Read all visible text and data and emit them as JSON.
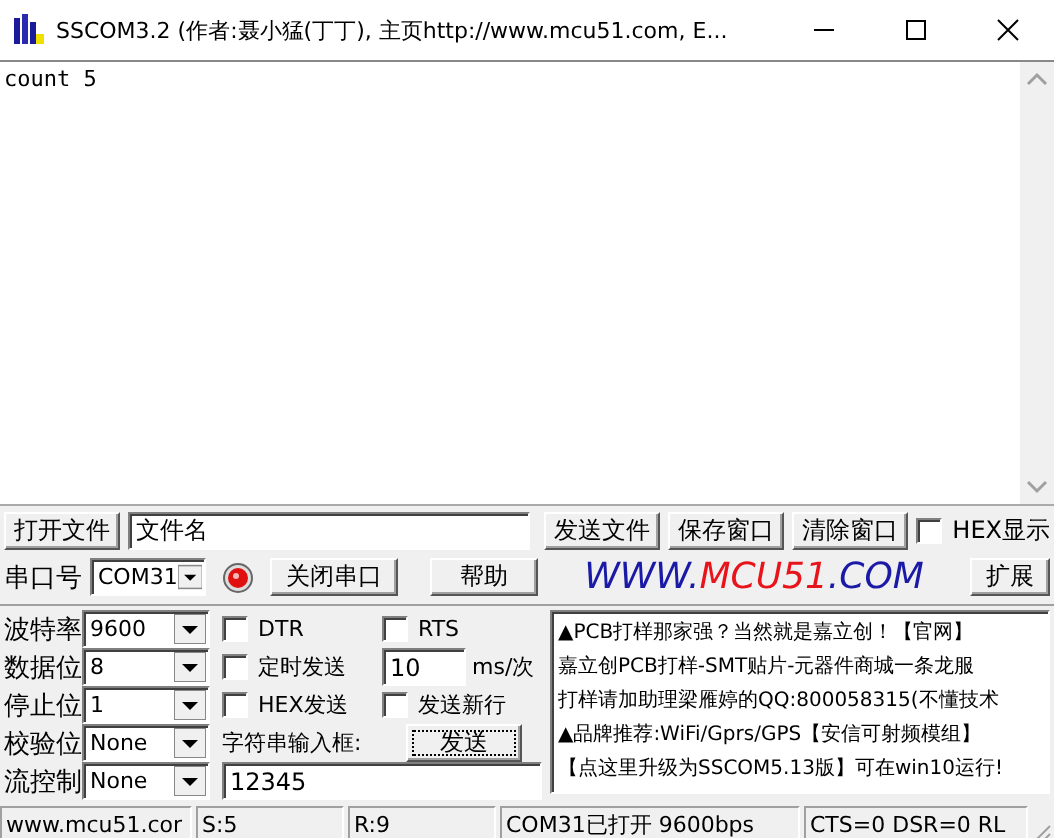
{
  "window": {
    "title": "SSCOM3.2 (作者:聂小猛(丁丁), 主页http://www.mcu51.com,  E..."
  },
  "receive_area": {
    "text": "count 5"
  },
  "file_row": {
    "open_button": "打开文件",
    "file_field": "文件名",
    "send_file_button": "发送文件",
    "save_button": "保存窗口",
    "clear_button": "清除窗口",
    "hex_display": {
      "label": "HEX显示",
      "checked": false
    }
  },
  "port_row": {
    "port_label": "串口号",
    "port": "COM31",
    "port_open": true,
    "toggle_button": "关闭串口",
    "help_button": "帮助",
    "logo": [
      "WWW.",
      "MCU51",
      ".COM"
    ],
    "expand_button": "扩展"
  },
  "settings": [
    {
      "label": "波特率",
      "value": "9600"
    },
    {
      "label": "数据位",
      "value": "8"
    },
    {
      "label": "停止位",
      "value": "1"
    },
    {
      "label": "校验位",
      "value": "None"
    },
    {
      "label": "流控制",
      "value": "None"
    }
  ],
  "dtr": {
    "label": "DTR",
    "checked": false
  },
  "rts": {
    "label": "RTS",
    "checked": false
  },
  "timed_send": {
    "label": "定时发送",
    "checked": false
  },
  "interval": {
    "value": "10",
    "unit": "ms/次"
  },
  "hex_send": {
    "label": "HEX发送",
    "checked": false
  },
  "send_newline": {
    "label": "发送新行",
    "checked": false
  },
  "input_label": "字符串输入框:",
  "send_button": "发送",
  "input_value": "12345",
  "notice_lines": [
    "▲PCB打样那家强？当然就是嘉立创！【官网】",
    "嘉立创PCB打样-SMT贴片-元器件商城一条龙服",
    "打样请加助理梁雁婷的QQ:800058315(不懂技术",
    "▲品牌推荐:WiFi/Gprs/GPS【安信可射频模组】",
    "【点这里升级为SSCOM5.13版】可在win10运行!"
  ],
  "status_bar": [
    "www.mcu51.cor",
    "S:5",
    "R:9",
    "COM31已打开  9600bps",
    "CTS=0 DSR=0 RL"
  ]
}
